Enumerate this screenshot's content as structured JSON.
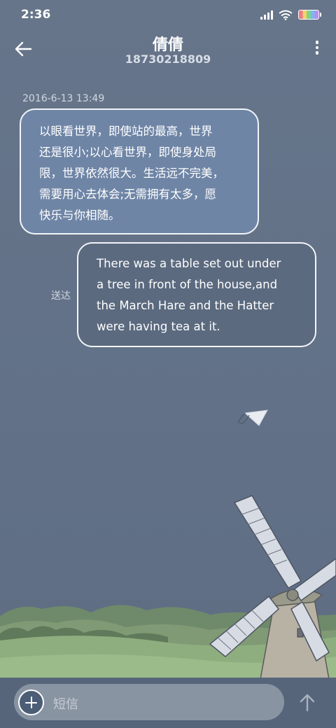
{
  "status_bar": {
    "time": "2:36"
  },
  "header": {
    "contact_name": "倩倩",
    "phone_number": "18730218809",
    "back_icon": "arrow-left-icon",
    "more_icon": "more-vertical-icon"
  },
  "conversation": {
    "timestamp": "2016-6-13 13:49",
    "incoming_message": {
      "lines": [
        "以眼看世界，即使站的最高，世界",
        "还是很小;以心看世界，即使身处局",
        "限，世界依然很大。生活远不完美，",
        "需要用心去体会;无需拥有太多，愿",
        "快乐与你相随。"
      ]
    },
    "outgoing_message": {
      "lines": [
        "There was a table set out under",
        "a tree in front of the house,and",
        "the March Hare and the Hatter",
        "were having tea at it."
      ],
      "status": "送达"
    }
  },
  "composer": {
    "placeholder": "短信",
    "add_icon": "plus-circle-icon",
    "send_icon": "arrow-up-icon"
  },
  "colors": {
    "background": "#657488",
    "incoming_bubble": "#6f85a6",
    "outgoing_bubble": "#5b6a7f",
    "input_bar": "#56657a"
  }
}
